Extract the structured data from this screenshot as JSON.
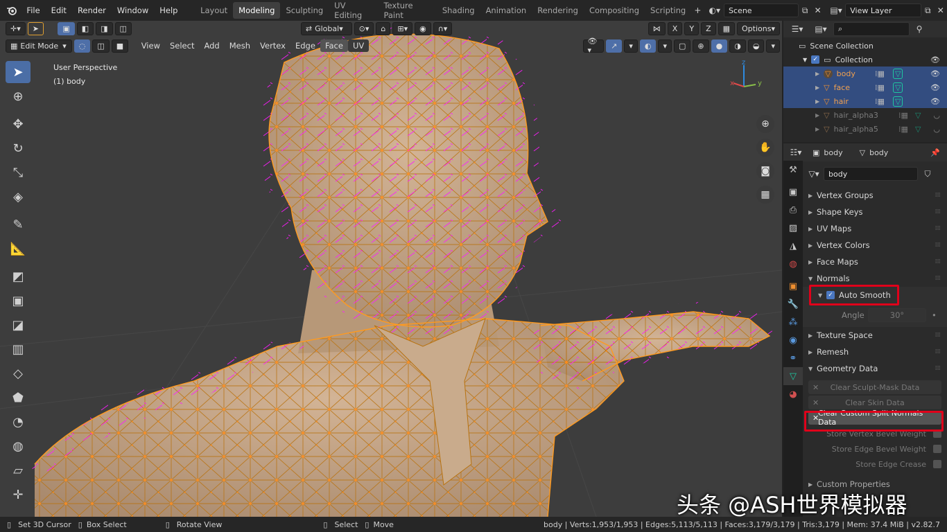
{
  "menus": [
    "File",
    "Edit",
    "Render",
    "Window",
    "Help"
  ],
  "workspaces": [
    "Layout",
    "Modeling",
    "Sculpting",
    "UV Editing",
    "Texture Paint",
    "Shading",
    "Animation",
    "Rendering",
    "Compositing",
    "Scripting"
  ],
  "scene": "Scene",
  "view_layer": "View Layer",
  "viewport": {
    "orientation": "Global",
    "options": "Options",
    "mode": "Edit Mode",
    "menus": [
      "View",
      "Select",
      "Add",
      "Mesh",
      "Vertex",
      "Edge",
      "Face",
      "UV"
    ],
    "active_menu": "Face",
    "overlay_line1": "User Perspective",
    "overlay_line2": "(1) body",
    "axis_x": "x",
    "axis_y": "y",
    "axis_z": "z"
  },
  "tools": [
    "select-box",
    "cursor",
    "move",
    "rotate",
    "scale",
    "transform",
    "annotate",
    "measure",
    "extrude",
    "inset",
    "bevel",
    "loop-cut",
    "knife",
    "poly-build",
    "spin",
    "smooth",
    "shrink-fatten",
    "shear",
    "rip"
  ],
  "outliner": {
    "title": "Scene Collection",
    "collection": "Collection",
    "items": [
      {
        "name": "body",
        "selected": true
      },
      {
        "name": "face",
        "selected": true
      },
      {
        "name": "hair",
        "selected": true
      },
      {
        "name": "hair_alpha3",
        "selected": false
      },
      {
        "name": "hair_alpha5",
        "selected": false
      }
    ]
  },
  "properties": {
    "object_name": "body",
    "mesh_name": "body",
    "data_name": "body",
    "panels_top": [
      "Vertex Groups",
      "Shape Keys",
      "UV Maps",
      "Vertex Colors",
      "Face Maps"
    ],
    "normals": "Normals",
    "auto_smooth": "Auto Smooth",
    "angle_label": "Angle",
    "angle_value": "30°",
    "texture_space": "Texture Space",
    "remesh": "Remesh",
    "geometry_data": "Geometry Data",
    "clear_sculpt_mask": "Clear Sculpt-Mask Data",
    "clear_skin": "Clear Skin Data",
    "clear_split_normals": "Clear Custom Split Normals Data",
    "store_vertex_bevel": "Store Vertex Bevel Weight",
    "store_edge_bevel": "Store Edge Bevel Weight",
    "store_edge_crease": "Store Edge Crease",
    "custom_properties": "Custom Properties"
  },
  "status": {
    "set_cursor": "Set 3D Cursor",
    "box_select": "Box Select",
    "rotate_view": "Rotate View",
    "select": "Select",
    "move": "Move",
    "stats": "body | Verts:1,953/1,953 | Edges:5,113/5,113 | Faces:3,179/3,179 | Tris:3,179 | Mem: 37.4 MiB | v2.82.7"
  },
  "watermark": "头条 @ASH世界模拟器",
  "colors": {
    "mesh": "#c7a88a",
    "normals": "#ff19ff",
    "edges": "#e88a16",
    "selection": "#334d80",
    "highlight": "#e0001a"
  }
}
